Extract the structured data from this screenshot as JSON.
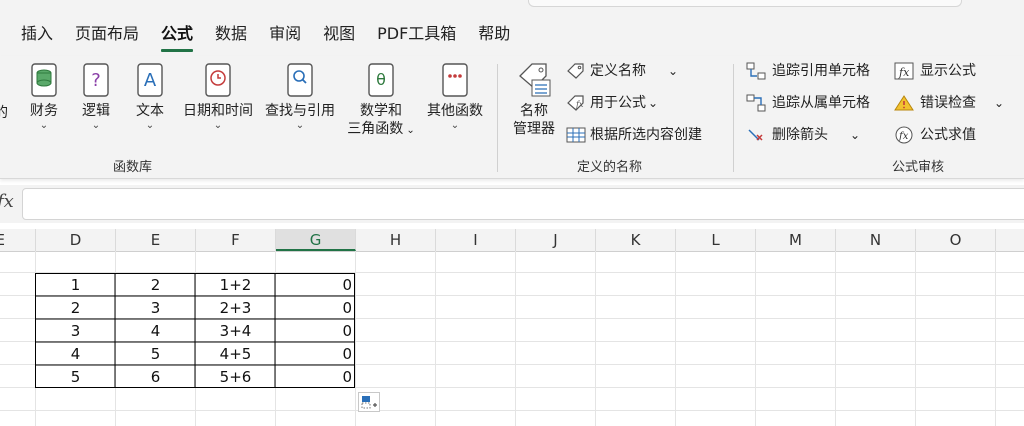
{
  "tabs": [
    "插入",
    "页面布局",
    "公式",
    "数据",
    "审阅",
    "视图",
    "PDF工具箱",
    "帮助"
  ],
  "active_tab": "公式",
  "ribbon": {
    "function_library": {
      "partial_label": "的",
      "finance": "财务",
      "logic": "逻辑",
      "text": "文本",
      "datetime": "日期和时间",
      "lookup": "查找与引用",
      "math_line1": "数学和",
      "math_line2": "三角函数",
      "other": "其他函数",
      "group_label": "函数库"
    },
    "defined_names": {
      "name_manager_line1": "名称",
      "name_manager_line2": "管理器",
      "define_name": "定义名称",
      "use_in_formula": "用于公式",
      "create_from_selection": "根据所选内容创建",
      "group_label": "定义的名称"
    },
    "formula_auditing": {
      "trace_precedents": "追踪引用单元格",
      "trace_dependents": "追踪从属单元格",
      "remove_arrows": "删除箭头",
      "show_formulas": "显示公式",
      "error_checking": "错误检查",
      "evaluate_formula": "公式求值",
      "group_label": "公式审核"
    }
  },
  "formula_bar": {
    "fx": "fx",
    "value": ""
  },
  "columns": [
    "E",
    "D",
    "E",
    "F",
    "G",
    "H",
    "I",
    "J",
    "K",
    "L",
    "M",
    "N",
    "O"
  ],
  "selected_column": "G",
  "table": [
    [
      "1",
      "2",
      "1+2",
      "0"
    ],
    [
      "2",
      "3",
      "2+3",
      "0"
    ],
    [
      "3",
      "4",
      "3+4",
      "0"
    ],
    [
      "4",
      "5",
      "4+5",
      "0"
    ],
    [
      "5",
      "6",
      "5+6",
      "0"
    ]
  ],
  "colors": {
    "accent": "#217346"
  }
}
